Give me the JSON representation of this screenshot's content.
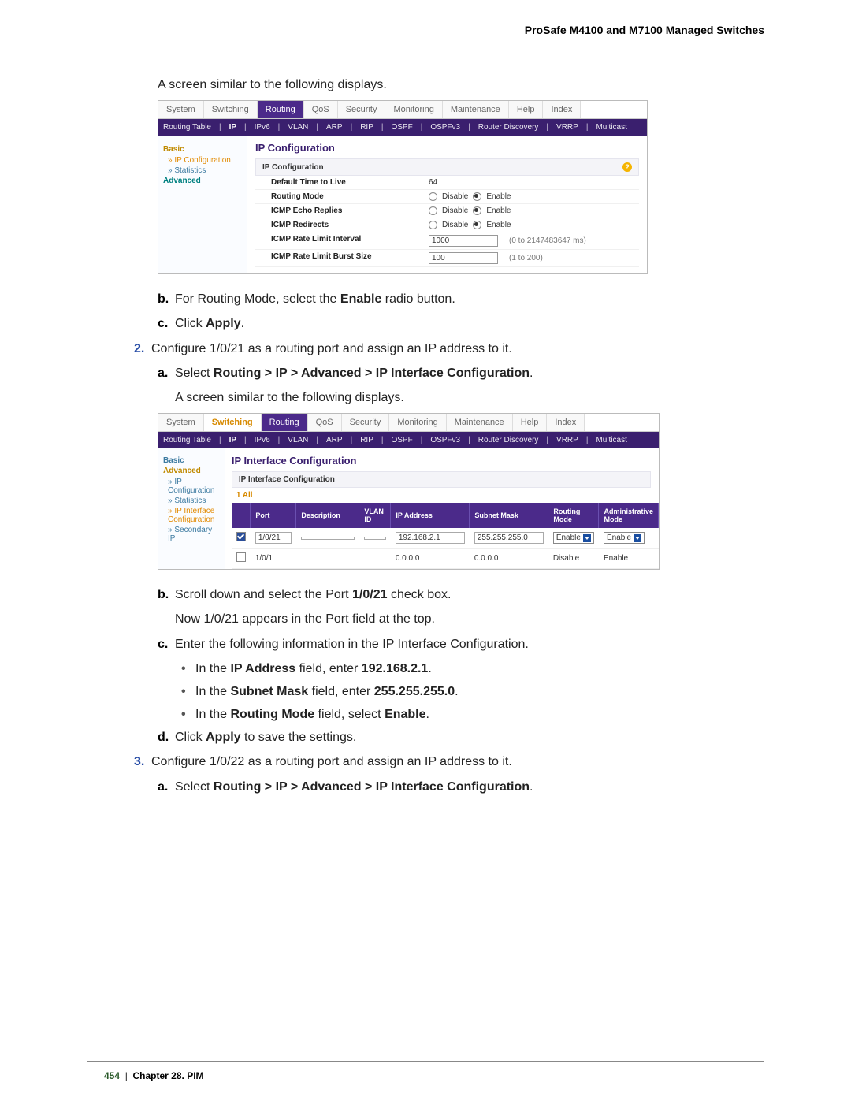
{
  "header": {
    "title": "ProSafe M4100 and M7100 Managed Switches"
  },
  "intro1": "A screen similar to the following displays.",
  "shot1": {
    "tabs": [
      "System",
      "Switching",
      "Routing",
      "QoS",
      "Security",
      "Monitoring",
      "Maintenance",
      "Help",
      "Index"
    ],
    "active_tab": "Routing",
    "subnav": [
      "Routing Table",
      "IP",
      "IPv6",
      "VLAN",
      "ARP",
      "RIP",
      "OSPF",
      "OSPFv3",
      "Router Discovery",
      "VRRP",
      "Multicast"
    ],
    "sidebar": {
      "basic": "Basic",
      "items": [
        "IP Configuration",
        "Statistics"
      ],
      "advanced": "Advanced"
    },
    "panel_title": "IP Configuration",
    "subhead": "IP Configuration",
    "rows": {
      "ttl_label": "Default Time to Live",
      "ttl_value": "64",
      "routing_mode": "Routing Mode",
      "icmp_echo": "ICMP Echo Replies",
      "icmp_redirects": "ICMP Redirects",
      "disable": "Disable",
      "enable": "Enable",
      "rate_interval_label": "ICMP Rate Limit Interval",
      "rate_interval_value": "1000",
      "rate_interval_hint": "(0 to 2147483647 ms)",
      "rate_burst_label": "ICMP Rate Limit Burst Size",
      "rate_burst_value": "100",
      "rate_burst_hint": "(1 to 200)"
    }
  },
  "steps1": {
    "b": "For Routing Mode, select the ",
    "b_bold": "Enable",
    "b_tail": " radio button.",
    "c": "Click ",
    "c_bold": "Apply",
    "c_tail": "."
  },
  "step2": {
    "num": "2.",
    "text": "Configure 1/0/21 as a routing port and assign an IP address to it.",
    "a": "Select ",
    "a_bold": "Routing > IP > Advanced > IP Interface Configuration",
    "a_tail": ".",
    "a2": "A screen similar to the following displays."
  },
  "shot2": {
    "tabs": [
      "System",
      "Switching",
      "Routing",
      "QoS",
      "Security",
      "Monitoring",
      "Maintenance",
      "Help",
      "Index"
    ],
    "active_tab": "Switching",
    "subnav": [
      "Routing Table",
      "IP",
      "IPv6",
      "VLAN",
      "ARP",
      "RIP",
      "OSPF",
      "OSPFv3",
      "Router Discovery",
      "VRRP",
      "Multicast"
    ],
    "sidebar": {
      "basic": "Basic",
      "advanced": "Advanced",
      "items": [
        "IP Configuration",
        "Statistics",
        "IP Interface Configuration",
        "Secondary IP"
      ]
    },
    "panel_title": "IP Interface Configuration",
    "subhead": "IP Interface Configuration",
    "filter": "1   All",
    "headers": [
      "",
      "Port",
      "Description",
      "VLAN ID",
      "IP Address",
      "Subnet Mask",
      "Routing Mode",
      "Administrative Mode"
    ],
    "row0": {
      "port": "1/0/21",
      "ip": "192.168.2.1",
      "mask": "255.255.255.0",
      "routing": "Enable",
      "admin": "Enable"
    },
    "row1": {
      "port": "1/0/1",
      "ip": "0.0.0.0",
      "mask": "0.0.0.0",
      "routing": "Disable",
      "admin": "Enable"
    }
  },
  "steps2": {
    "b": "Scroll down and select the Port ",
    "b_bold": "1/0/21",
    "b_tail": " check box.",
    "b_note": "Now 1/0/21 appears in the Port field at the top.",
    "c": "Enter the following information in the IP Interface Configuration.",
    "c1a": "In the ",
    "c1b": "IP Address",
    "c1c": " field, enter ",
    "c1d": "192.168.2.1",
    "c1e": ".",
    "c2a": "In the ",
    "c2b": "Subnet Mask",
    "c2c": " field, enter ",
    "c2d": "255.255.255.0",
    "c2e": ".",
    "c3a": "In the ",
    "c3b": "Routing Mode",
    "c3c": " field, select ",
    "c3d": "Enable",
    "c3e": ".",
    "d": "Click ",
    "d_bold": "Apply",
    "d_tail": " to save the settings."
  },
  "step3": {
    "num": "3.",
    "text": "Configure 1/0/22 as a routing port and assign an IP address to it.",
    "a": "Select ",
    "a_bold": "Routing > IP > Advanced > IP Interface Configuration",
    "a_tail": "."
  },
  "footer": {
    "pg": "454",
    "sep": "|",
    "chapter": "Chapter 28.  PIM"
  }
}
